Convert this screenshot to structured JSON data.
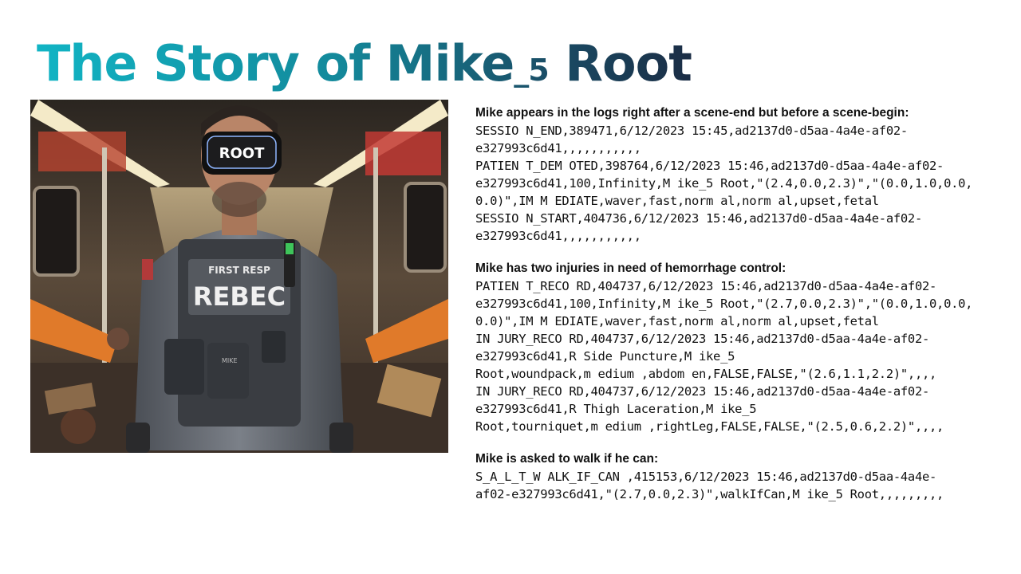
{
  "title": {
    "main": "The Story of Mike",
    "sub": "_5",
    "tail": " Root"
  },
  "photo": {
    "visor_text": "ROOT",
    "patch_top": "FIRST RESP",
    "patch_name": "REBEC",
    "pouch_tag": "MIKE"
  },
  "sections": [
    {
      "heading": "Mike appears in the logs right after a scene-end but before a scene-begin:",
      "lines": [
        "SESSIO N_END,389471,6/12/2023 15:45,ad2137d0-d5aa-4a4e-af02-",
        "e327993c6d41,,,,,,,,,,,",
        "PATIEN T_DEM OTED,398764,6/12/2023 15:46,ad2137d0-d5aa-4a4e-af02-",
        "e327993c6d41,100,Infinity,M ike_5 Root,\"(2.4,0.0,2.3)\",\"(0.0,1.0,0.0,",
        "0.0)\",IM M EDIATE,waver,fast,norm al,norm al,upset,fetal",
        "SESSIO N_START,404736,6/12/2023 15:46,ad2137d0-d5aa-4a4e-af02-",
        "e327993c6d41,,,,,,,,,,,"
      ]
    },
    {
      "heading": "Mike has two injuries in need of hemorrhage control:",
      "lines": [
        "PATIEN T_RECO RD,404737,6/12/2023 15:46,ad2137d0-d5aa-4a4e-af02-",
        "e327993c6d41,100,Infinity,M ike_5 Root,\"(2.7,0.0,2.3)\",\"(0.0,1.0,0.0,",
        "0.0)\",IM M EDIATE,waver,fast,norm al,norm al,upset,fetal",
        "IN JURY_RECO RD,404737,6/12/2023 15:46,ad2137d0-d5aa-4a4e-af02-",
        "e327993c6d41,R Side Puncture,M ike_5",
        "Root,woundpack,m edium ,abdom en,FALSE,FALSE,\"(2.6,1.1,2.2)\",,,,",
        "IN JURY_RECO RD,404737,6/12/2023 15:46,ad2137d0-d5aa-4a4e-af02-",
        "e327993c6d41,R Thigh Laceration,M ike_5",
        "Root,tourniquet,m edium ,rightLeg,FALSE,FALSE,\"(2.5,0.6,2.2)\",,,,"
      ]
    },
    {
      "heading": "Mike is asked to walk if he can:",
      "lines": [
        "S_A_L_T_W ALK_IF_CAN ,415153,6/12/2023 15:46,ad2137d0-d5aa-4a4e-",
        "af02-e327993c6d41,\"(2.7,0.0,2.3)\",walkIfCan,M ike_5 Root,,,,,,,,,"
      ]
    }
  ]
}
